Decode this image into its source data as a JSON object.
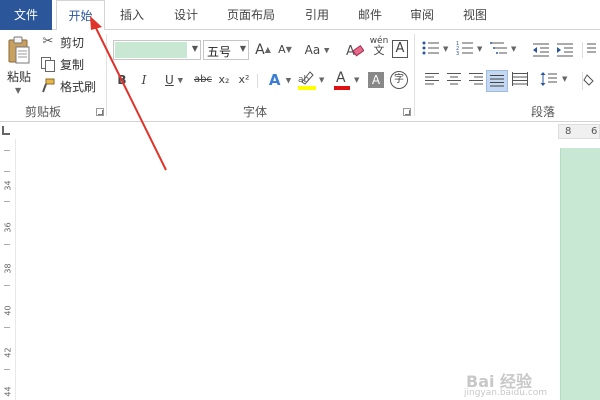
{
  "tabs": {
    "file": "文件",
    "home": "开始",
    "insert": "插入",
    "design": "设计",
    "layout": "页面布局",
    "references": "引用",
    "mailings": "邮件",
    "review": "审阅",
    "view": "视图"
  },
  "clipboard": {
    "paste_label": "粘贴",
    "cut_label": "剪切",
    "copy_label": "复制",
    "format_painter_label": "格式刷",
    "group_label": "剪贴板"
  },
  "font": {
    "font_name_value": "",
    "font_size_value": "五号",
    "group_label": "字体",
    "grow_glyph": "A",
    "shrink_glyph": "A",
    "case_glyph": "Aa",
    "pinyin_glyph": "wén",
    "border_glyph": "A",
    "bold_glyph": "B",
    "italic_glyph": "I",
    "underline_glyph": "U",
    "strike_glyph": "abc",
    "sub_glyph": "x₂",
    "sup_glyph": "x²",
    "effects_glyph": "A",
    "color_glyph": "A",
    "shade_glyph": "A",
    "enclose_glyph": "字",
    "highlight_color": "#ffff00",
    "font_color": "#e01010"
  },
  "paragraph": {
    "group_label": "段落"
  },
  "rulers": {
    "horizontal_numbers": [
      "8",
      "6"
    ],
    "vertical_numbers": [
      "34",
      "36",
      "38",
      "40",
      "42",
      "44"
    ]
  },
  "colors": {
    "file_tab_bg": "#2b579a",
    "highlight_green": "#c9e8d3",
    "arrow_red": "#e0332a"
  },
  "watermark": {
    "main": "Bai 经验",
    "sub": "jingyan.baidu.com"
  }
}
